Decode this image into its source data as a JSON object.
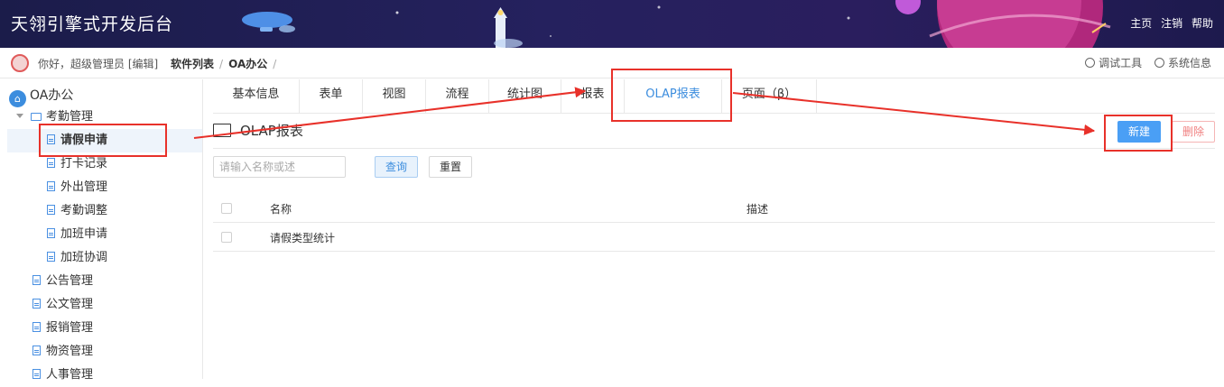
{
  "header": {
    "title": "天翎引擎式开发后台",
    "links": [
      "主页",
      "注销",
      "帮助"
    ]
  },
  "subbar": {
    "greeting": "你好，超级管理员",
    "edit_label": "[编辑]",
    "breadcrumb": [
      "软件列表",
      "OA办公"
    ],
    "separator": "/",
    "tools": [
      "调试工具",
      "系统信息"
    ]
  },
  "sidebar": {
    "root_label": "OA办公",
    "root_icon": "home-icon",
    "group_label": "考勤管理",
    "group_items": [
      "请假申请",
      "打卡记录",
      "外出管理",
      "考勤调整",
      "加班申请",
      "加班协调"
    ],
    "active_item": "请假申请",
    "top_items": [
      "公告管理",
      "公文管理",
      "报销管理",
      "物资管理",
      "人事管理"
    ]
  },
  "tabs": {
    "items": [
      "基本信息",
      "表单",
      "视图",
      "流程",
      "统计图",
      "报表",
      "OLAP报表",
      "页面（β）"
    ],
    "active": "OLAP报表"
  },
  "main": {
    "section_title": "OLAP报表",
    "new_button": "新建",
    "delete_button": "删除",
    "search_placeholder": "请输入名称或述",
    "query_button": "查询",
    "reset_button": "重置",
    "columns": [
      "名称",
      "描述"
    ],
    "rows": [
      {
        "name": "请假类型统计",
        "desc": ""
      }
    ]
  },
  "colors": {
    "accent": "#3c8dde",
    "primary_button": "#4a9ff5",
    "annotation": "#e8312a",
    "header_bg": "#1b1c4a"
  }
}
